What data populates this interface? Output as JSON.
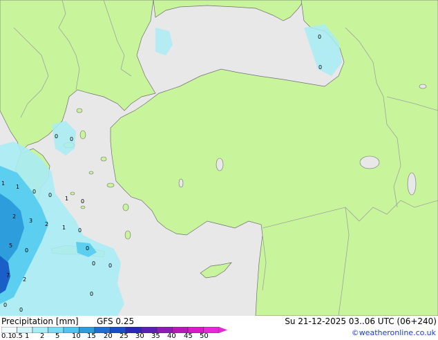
{
  "map": {
    "colors": {
      "land": "#c8f59c",
      "sea": "#e8e8e8",
      "border": "#a0a0a0",
      "coast": "#6e6e6e",
      "precip_light": "#a8ecf5",
      "precip_mid": "#5ccff0",
      "precip_heavy": "#2d9ddc",
      "precip_dark": "#1a5fc8"
    },
    "value_labels": [
      "0",
      "0",
      "0",
      "0",
      "0",
      "1",
      "1",
      "0",
      "0",
      "1",
      "0",
      "2",
      "3",
      "2",
      "1",
      "0",
      "5",
      "0",
      "7",
      "2",
      "0",
      "0",
      "0",
      "0",
      "0",
      "0",
      "0"
    ]
  },
  "legend": {
    "title": "Precipitation [mm]",
    "model": "GFS 0.25",
    "datetime": "Su 21-12-2025 03..06 UTC (06+240)",
    "credit": "©weatheronline.co.uk",
    "ticks": [
      "0.1",
      "0.5",
      "1",
      "2",
      "5",
      "10",
      "15",
      "20",
      "25",
      "30",
      "35",
      "40",
      "45",
      "50"
    ],
    "colors": [
      "#f2fcfe",
      "#d2f4fb",
      "#a8ecf5",
      "#7adcf2",
      "#4fc4ec",
      "#2d9ddc",
      "#1f6fd2",
      "#1a4cc8",
      "#2a28b8",
      "#5a1fb4",
      "#8c1ab4",
      "#b818b8",
      "#d81ac8",
      "#e628d8"
    ]
  }
}
